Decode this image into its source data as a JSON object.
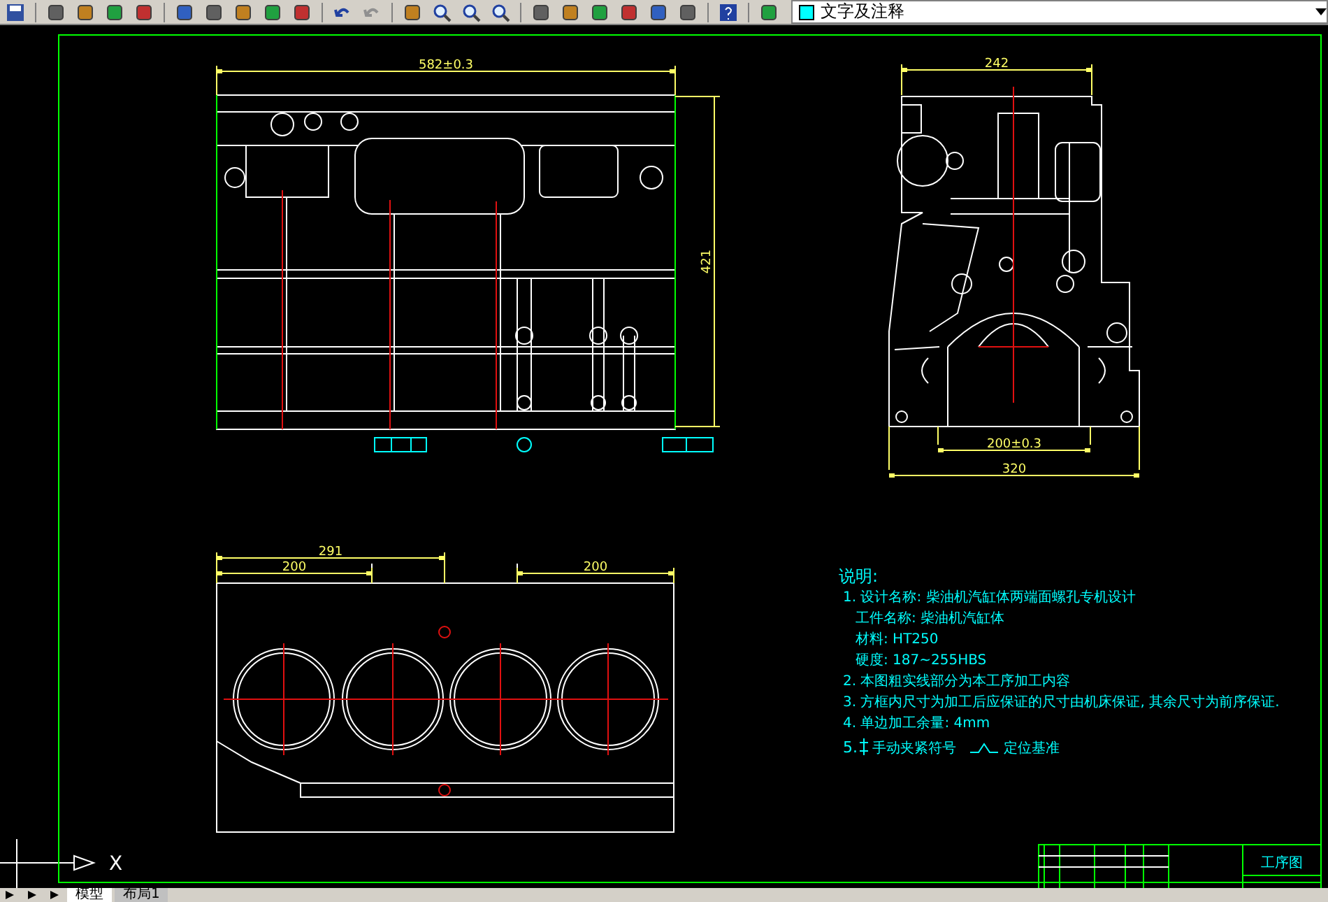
{
  "toolbar": {
    "layer_name": "文字及注释"
  },
  "drawing": {
    "front_view": {
      "width_dim": "582±0.3",
      "height_dim": "421"
    },
    "side_view": {
      "width_dim": "242",
      "bolt_dim": "200±0.3",
      "bottom_dim": "320"
    },
    "top_view": {
      "length_dim": "291",
      "left_dim": "200",
      "right_dim": "200"
    },
    "notes": {
      "title": "说明:",
      "lines": [
        {
          "kind": "item",
          "text": "1. 设计名称: 柴油机汽缸体两端面螺孔专机设计"
        },
        {
          "kind": "sub",
          "text": "工件名称: 柴油机汽缸体"
        },
        {
          "kind": "sub",
          "text": "材料: HT250"
        },
        {
          "kind": "sub",
          "text": "硬度: 187~255HBS"
        },
        {
          "kind": "item",
          "text": "2. 本图粗实线部分为本工序加工内容"
        },
        {
          "kind": "item",
          "text": "3. 方框内尺寸为加工后应保证的尺寸由机床保证, 其余尺寸为前序保证."
        },
        {
          "kind": "item",
          "text": "4. 单边加工余量: 4mm"
        }
      ],
      "symbol_number": "5.",
      "clamp_label": "手动夹紧符号",
      "datum_label": "定位基准"
    },
    "title_block": {
      "title": "工序图"
    },
    "ucs_axis_label": "X"
  },
  "layout_tabs": [
    {
      "label": "模型",
      "selected": true
    },
    {
      "label": "布局1",
      "selected": false
    }
  ]
}
